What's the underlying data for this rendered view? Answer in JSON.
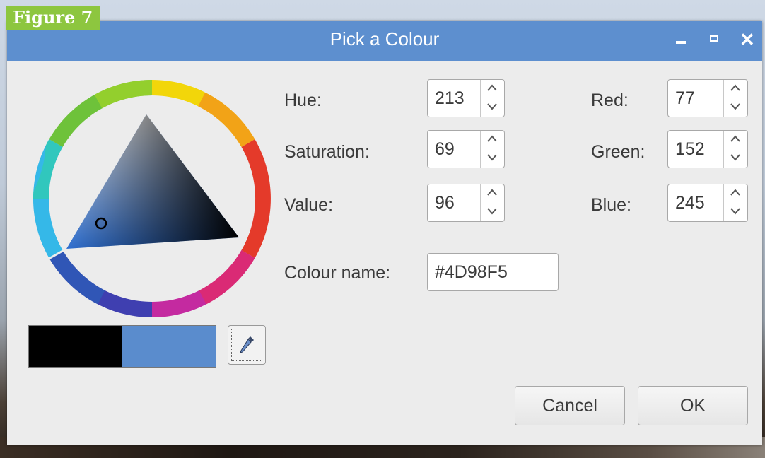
{
  "figure_label": "Figure 7",
  "window": {
    "title": "Pick a Colour",
    "controls": {
      "minimize_icon": "minimize-icon",
      "maximize_icon": "maximize-icon",
      "close_icon": "close-icon"
    }
  },
  "hsv": {
    "hue_label": "Hue:",
    "hue_value": "213",
    "saturation_label": "Saturation:",
    "saturation_value": "69",
    "value_label": "Value:",
    "value_value": "96"
  },
  "rgb": {
    "red_label": "Red:",
    "red_value": "77",
    "green_label": "Green:",
    "green_value": "152",
    "blue_label": "Blue:",
    "blue_value": "245"
  },
  "colour_name": {
    "label": "Colour name:",
    "value": "#4D98F5"
  },
  "swatches": {
    "previous_color": "#000000",
    "current_color": "#5a8ccd"
  },
  "colors": {
    "titlebar": "#5d8fcf",
    "figure_label_bg": "#8dc63f"
  },
  "buttons": {
    "cancel": "Cancel",
    "ok": "OK"
  }
}
